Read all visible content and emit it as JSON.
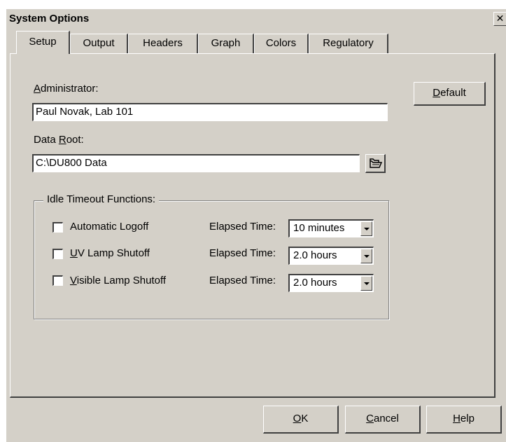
{
  "window": {
    "title": "System Options",
    "close_icon": "close-icon",
    "close_glyph": "✕"
  },
  "tabs": [
    {
      "label": "Setup",
      "active": true
    },
    {
      "label": "Output"
    },
    {
      "label": "Headers"
    },
    {
      "label": "Graph"
    },
    {
      "label": "Colors"
    },
    {
      "label": "Regulatory"
    }
  ],
  "setup": {
    "administrator": {
      "label_mnemonic": "A",
      "label_rest": "dministrator:",
      "value": "Paul Novak, Lab 101"
    },
    "data_root": {
      "label_before": "Data ",
      "label_mnemonic": "R",
      "label_after": "oot:",
      "value": "C:\\DU800 Data",
      "browse_icon": "open-folder-icon"
    },
    "default_button": {
      "mnemonic": "D",
      "rest": "efault"
    },
    "idle_timeout": {
      "title": "Idle Timeout Functions:",
      "rows": [
        {
          "label_before": "Automatic Lo",
          "label_mnemonic": "g",
          "label_after": "off",
          "checked": false,
          "elapsed_label": "Elapsed Time:",
          "value": "10 minutes"
        },
        {
          "label_before": "",
          "label_mnemonic": "U",
          "label_after": "V Lamp Shutoff",
          "checked": false,
          "elapsed_label": "Elapsed Time:",
          "value": "2.0 hours"
        },
        {
          "label_before": "",
          "label_mnemonic": "V",
          "label_after": "isible Lamp Shutoff",
          "checked": false,
          "elapsed_label": "Elapsed Time:",
          "value": "2.0 hours"
        }
      ]
    }
  },
  "footer": {
    "ok": {
      "mnemonic": "O",
      "rest": "K"
    },
    "cancel": {
      "mnemonic": "C",
      "rest": "ancel"
    },
    "help": {
      "mnemonic": "H",
      "rest": "elp"
    }
  }
}
